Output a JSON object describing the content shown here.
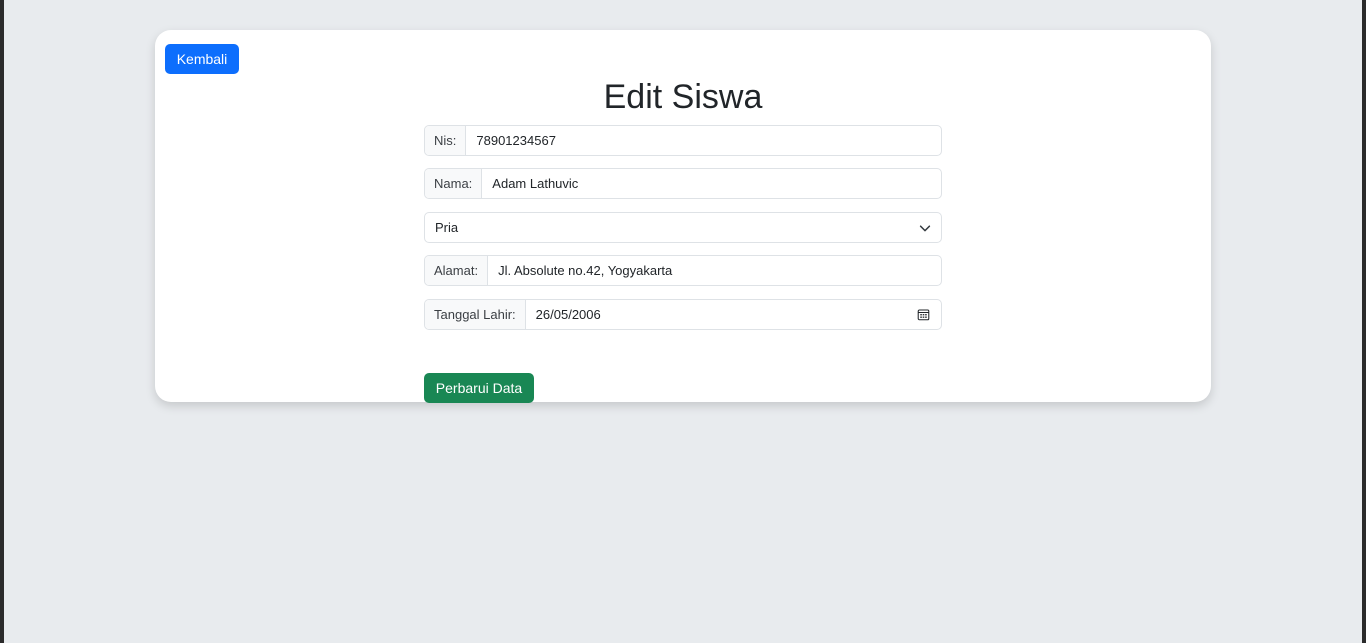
{
  "header": {
    "back_label": "Kembali",
    "title": "Edit Siswa"
  },
  "form": {
    "nis": {
      "label": "Nis:",
      "value": "78901234567"
    },
    "nama": {
      "label": "Nama:",
      "value": "Adam Lathuvic"
    },
    "gender": {
      "selected": "Pria"
    },
    "alamat": {
      "label": "Alamat:",
      "value": "Jl. Absolute no.42, Yogyakarta"
    },
    "tanggal_lahir": {
      "label": "Tanggal Lahir:",
      "value": "26/05/2006"
    },
    "submit_label": "Perbarui Data"
  },
  "icons": {
    "select_chevron": "chevron-down-icon",
    "date_picker": "calendar-icon"
  },
  "colors": {
    "primary": "#0d6efd",
    "success": "#198754",
    "page_bg": "#e8ebee"
  }
}
